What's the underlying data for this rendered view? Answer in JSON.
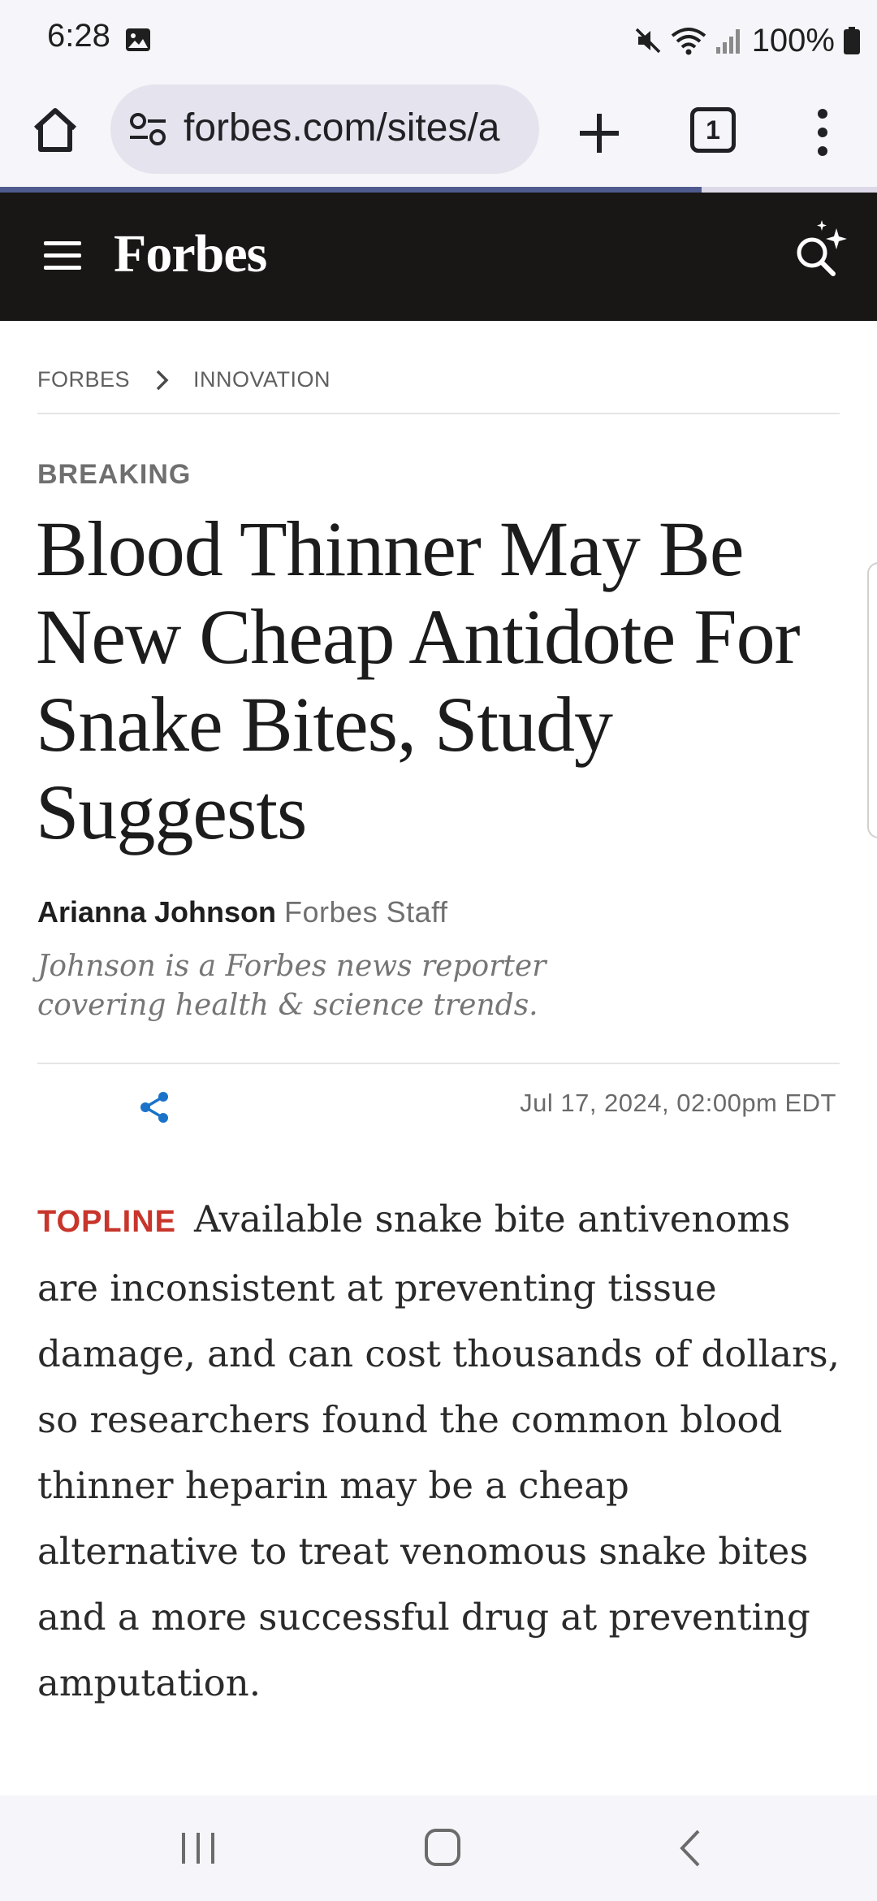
{
  "status_bar": {
    "time": "6:28",
    "battery": "100%",
    "icons": [
      "image-notification-icon",
      "mute-icon",
      "wifi-icon",
      "signal-icon",
      "battery-icon"
    ]
  },
  "browser": {
    "url": "forbes.com/sites/a",
    "tab_count": "1",
    "page_load_progress": 0.8
  },
  "site": {
    "logo": "Forbes"
  },
  "breadcrumb": {
    "items": [
      "FORBES",
      "INNOVATION"
    ]
  },
  "article": {
    "kicker": "BREAKING",
    "headline": "Blood Thinner May Be New Cheap Antidote For Snake Bites, Study Suggests",
    "author_name": "Arianna Johnson",
    "author_role": "Forbes Staff",
    "author_bio": "Johnson is a Forbes news reporter covering health & science trends.",
    "published": "Jul 17, 2024, 02:00pm EDT",
    "topline_label": "TOPLINE",
    "topline_text": "Available snake bite antivenoms are inconsistent at preventing tissue damage, and can cost thousands of dollars, so researchers found the common blood thinner heparin may be a cheap alternative to treat venomous snake bites and a more successful drug at preventing amputation."
  },
  "colors": {
    "forbes_header_bg": "#181716",
    "topline_red": "#c8352b",
    "share_blue": "#1a73c8",
    "progress": "#4f5a8e"
  }
}
